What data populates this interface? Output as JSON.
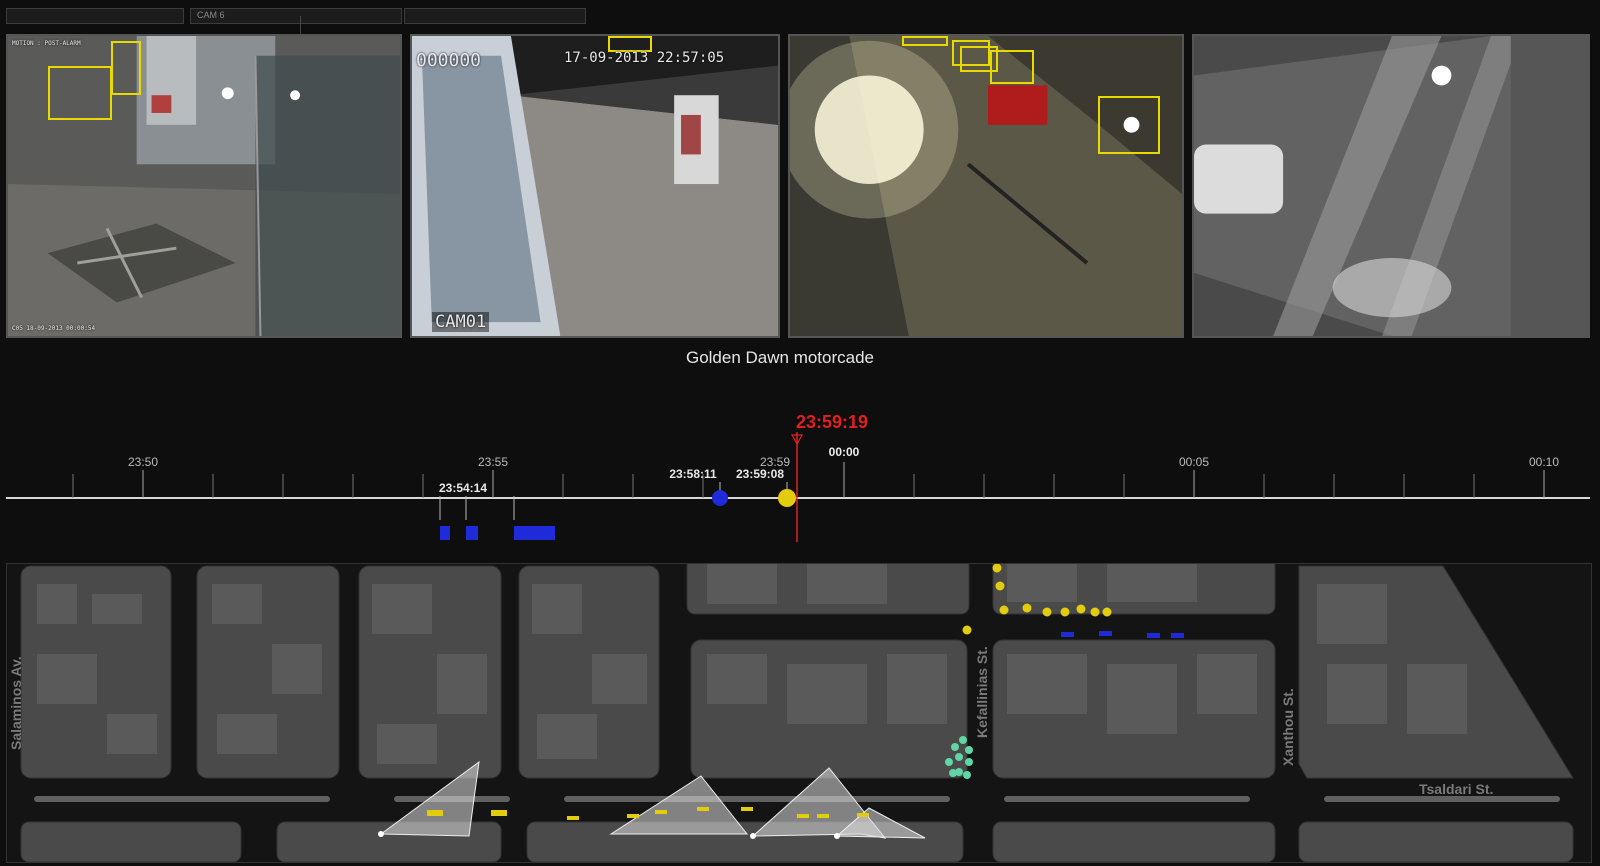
{
  "top_strip": {
    "label": "CAM 6"
  },
  "cameras": [
    {
      "name": "camera-1",
      "motion_text": "MOTION : POST-ALARM",
      "footer_text": "C05 18-09-2013 00:00:54"
    },
    {
      "name": "camera-2",
      "counter_text": "000000",
      "timestamp_text": "17-09-2013 22:57:05",
      "cam_label": "CAM01"
    },
    {
      "name": "camera-3"
    },
    {
      "name": "camera-4"
    }
  ],
  "caption": "Golden Dawn motorcade",
  "timeline": {
    "ticks": [
      "23:50",
      "23:55",
      "23:59",
      "00:00",
      "00:05",
      "00:10"
    ],
    "events": [
      {
        "label": "23:54:14"
      },
      {
        "label": "23:58:11",
        "color": "#1f2bd9"
      },
      {
        "label": "23:59:08",
        "color": "#e3cc10"
      }
    ],
    "current_time": "23:59:19",
    "current_color": "#e02020",
    "block_color": "#1f2bd9"
  },
  "map": {
    "streets": [
      "Salaminos Av.",
      "Kefallinias St.",
      "Xanthou St.",
      "Tsaldari St."
    ],
    "colors": {
      "yellow": "#e3cc10",
      "blue": "#1f2bd9",
      "green": "#5fd6a6"
    }
  }
}
